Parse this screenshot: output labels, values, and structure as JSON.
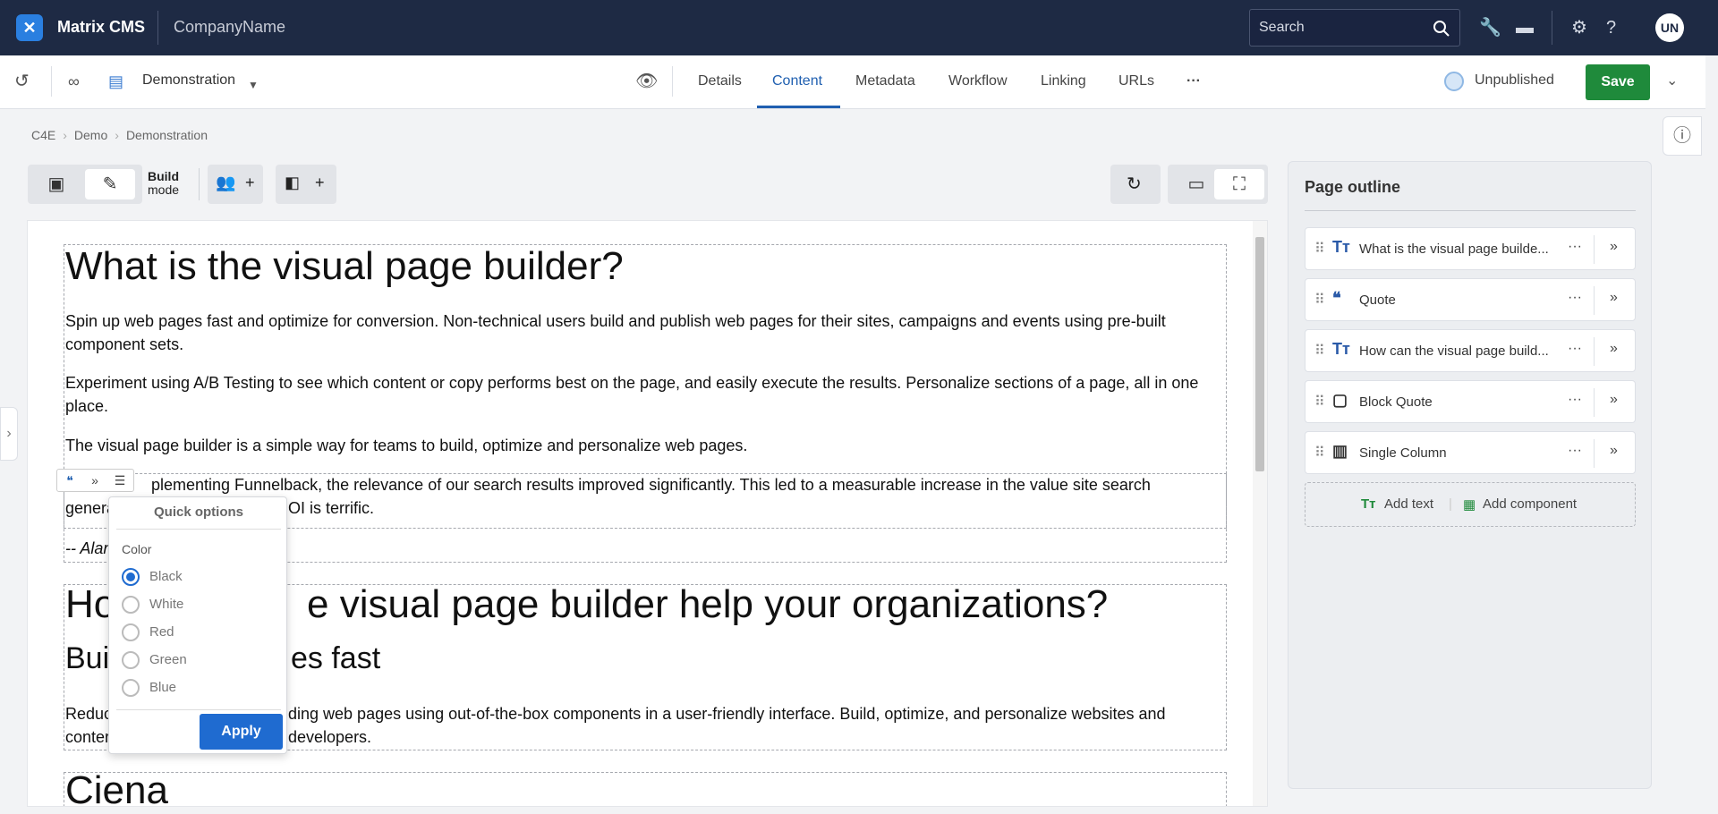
{
  "topbar": {
    "app_name": "Matrix CMS",
    "company": "CompanyName",
    "search_placeholder": "Search",
    "user_initials": "UN"
  },
  "assetbar": {
    "asset_name": "Demonstration",
    "tabs": [
      "Details",
      "Content",
      "Metadata",
      "Workflow",
      "Linking",
      "URLs"
    ],
    "more": "···",
    "active_tab": "Content",
    "status": "Unpublished",
    "save_label": "Save"
  },
  "breadcrumb": [
    "C4E",
    "Demo",
    "Demonstration"
  ],
  "toolbar": {
    "build_label_1": "Build",
    "build_label_2": "mode",
    "plus": "+"
  },
  "content": {
    "heading1": "What is the visual page builder?",
    "para1": "Spin up web pages fast and optimize for conversion. Non-technical users build and publish web pages for their sites, campaigns and events using pre-built component sets.",
    "para2": "Experiment using A/B Testing to see which content or copy performs best on the page, and easily execute the results. Personalize sections of a page, all in one place.",
    "para3": "The visual page builder is a simple way for teams to build, optimize and personalize web pages.",
    "quote_line1": "plementing Funnelback, the relevance of our search results improved significantly. This led to a measurable increase in the value site search",
    "quote_line2_a": "genera",
    "quote_line2_b": "OI is terrific.",
    "quote_author": "-- Alan",
    "heading2_a": "Ho",
    "heading2_b": "e visual page builder help your organizations?",
    "heading3_a": "Bui",
    "heading3_b": "es fast",
    "para4_a": "Reduc",
    "para4_b": "ding web pages using out-of-the-box components in a user-friendly interface. Build, optimize, and personalize websites and",
    "para4_c": "conter",
    "para4_d": "developers.",
    "heading4": "Ciena"
  },
  "quick_options": {
    "title": "Quick options",
    "color_label": "Color",
    "options": [
      "Black",
      "White",
      "Red",
      "Green",
      "Blue"
    ],
    "selected": "Black",
    "apply_label": "Apply"
  },
  "outline": {
    "title": "Page outline",
    "items": [
      {
        "label": "What is the visual page builde...",
        "icon": "text-icon"
      },
      {
        "label": "Quote",
        "icon": "quote-icon"
      },
      {
        "label": "How can the visual page build...",
        "icon": "text-icon"
      },
      {
        "label": "Block Quote",
        "icon": "block-quote-icon"
      },
      {
        "label": "Single Column",
        "icon": "column-icon"
      }
    ],
    "add_text": "Add text",
    "add_component": "Add component"
  }
}
